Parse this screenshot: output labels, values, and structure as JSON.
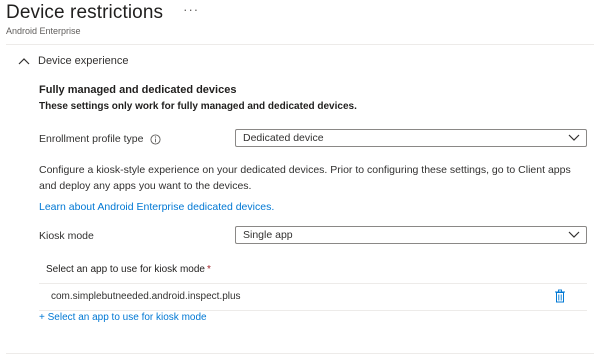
{
  "header": {
    "title": "Device restrictions",
    "more": "···",
    "subtitle": "Android Enterprise"
  },
  "section": {
    "title": "Device experience",
    "heading": "Fully managed and dedicated devices",
    "note": "These settings only work for fully managed and dedicated devices."
  },
  "enrollment": {
    "label": "Enrollment profile type",
    "value": "Dedicated device"
  },
  "description": "Configure a kiosk-style experience on your dedicated devices. Prior to configuring these settings, go to Client apps and deploy any apps you want to the devices.",
  "learn_link": "Learn about Android Enterprise dedicated devices.",
  "kiosk": {
    "label": "Kiosk mode",
    "value": "Single app"
  },
  "app_select": {
    "label": "Select an app to use for kiosk mode",
    "required_marker": "*",
    "selected_app": "com.simplebutneeded.android.inspect.plus",
    "add_link": "+ Select an app to use for kiosk mode"
  },
  "colors": {
    "link": "#0078d4",
    "text": "#323130",
    "required": "#a4262c",
    "border": "#8a8886"
  }
}
